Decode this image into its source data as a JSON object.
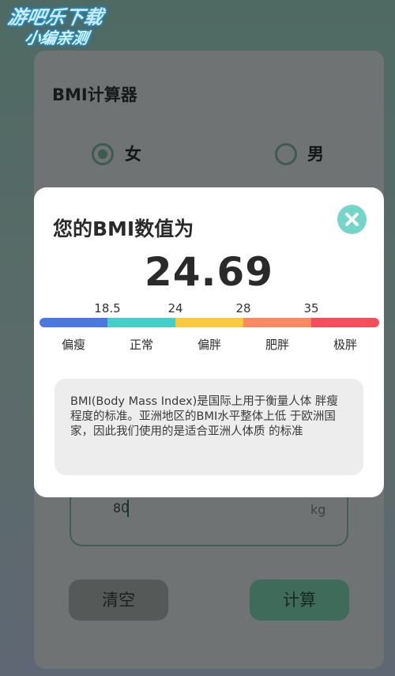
{
  "watermark": {
    "line1": "游吧乐下载",
    "line2": "小编亲测"
  },
  "app": {
    "title": "BMI计算器"
  },
  "gender": {
    "female_label": "女",
    "male_label": "男",
    "selected": "女"
  },
  "weight": {
    "value": "80",
    "unit": "kg"
  },
  "buttons": {
    "clear": "清空",
    "calculate": "计算"
  },
  "modal": {
    "title": "您的BMI数值为",
    "value": "24.69",
    "ticks": [
      "18.5",
      "24",
      "28",
      "35"
    ],
    "categories": [
      "偏瘦",
      "正常",
      "偏胖",
      "肥胖",
      "极胖"
    ],
    "scale_colors": [
      "#4a78dd",
      "#45cfc9",
      "#fbc842",
      "#fb8a62",
      "#f64e5c"
    ],
    "note": "BMI(Body Mass Index)是国际上用于衡量人体 胖瘦程度的标准。亚洲地区的BMI水平整体上低 于欧洲国家，因此我们使用的是适合亚洲人体质 的标准"
  },
  "colors": {
    "accent": "#73d6c8",
    "primary_dark": "#3f6b5a"
  },
  "icons": {
    "close": "close-icon"
  }
}
